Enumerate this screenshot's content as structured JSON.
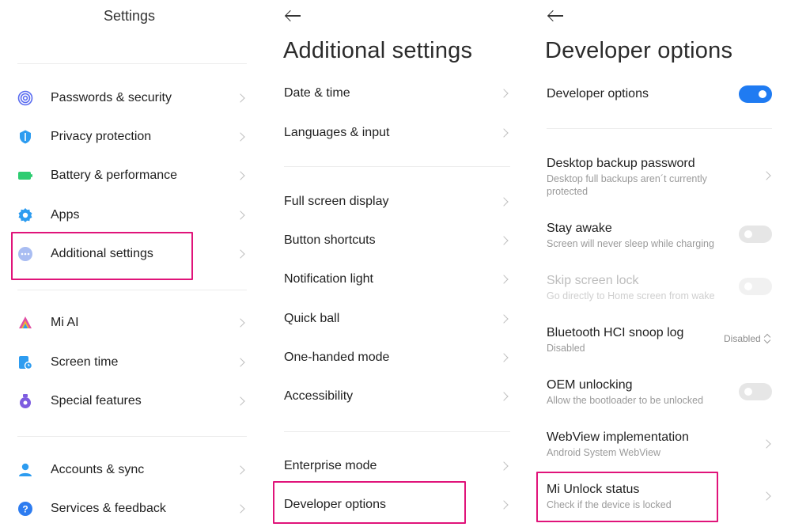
{
  "settings": {
    "title": "Settings",
    "items": [
      {
        "label": "Passwords & security",
        "icon": "fingerprint-icon",
        "color": "#5a6cf0"
      },
      {
        "label": "Privacy protection",
        "icon": "privacy-shield-icon",
        "color": "#2d9cf0"
      },
      {
        "label": "Battery & performance",
        "icon": "battery-icon",
        "color": "#2ecc71"
      },
      {
        "label": "Apps",
        "icon": "gear-icon",
        "color": "#2d9cf0"
      },
      {
        "label": "Additional settings",
        "icon": "more-dots-icon",
        "color": "#9fb4ef"
      },
      {
        "label": "Mi AI",
        "icon": "mi-ai-icon",
        "color": "#e04fa3"
      },
      {
        "label": "Screen time",
        "icon": "screen-time-icon",
        "color": "#2d9cf0"
      },
      {
        "label": "Special features",
        "icon": "special-features-icon",
        "color": "#7d5ce0"
      },
      {
        "label": "Accounts & sync",
        "icon": "person-icon",
        "color": "#2d9cf0"
      },
      {
        "label": "Services & feedback",
        "icon": "help-icon",
        "color": "#2d7cf0"
      }
    ]
  },
  "additional": {
    "title": "Additional settings",
    "items": [
      {
        "label": "Date & time"
      },
      {
        "label": "Languages & input"
      },
      {
        "label": "Full screen display"
      },
      {
        "label": "Button shortcuts"
      },
      {
        "label": "Notification light"
      },
      {
        "label": "Quick ball"
      },
      {
        "label": "One-handed mode"
      },
      {
        "label": "Accessibility"
      },
      {
        "label": "Enterprise mode"
      },
      {
        "label": "Developer options"
      }
    ]
  },
  "developer": {
    "title": "Developer options",
    "master_label": "Developer options",
    "master_on": true,
    "items": [
      {
        "title": "Desktop backup password",
        "subtitle": "Desktop full backups aren´t currently protected"
      },
      {
        "title": "Stay awake",
        "subtitle": "Screen will never sleep while charging"
      },
      {
        "title": "Skip screen lock",
        "subtitle": "Go directly to Home screen from wake"
      },
      {
        "title": "Bluetooth HCI snoop log",
        "subtitle": "Disabled",
        "value": "Disabled"
      },
      {
        "title": "OEM unlocking",
        "subtitle": "Allow the bootloader to be unlocked"
      },
      {
        "title": "WebView implementation",
        "subtitle": "Android System WebView"
      },
      {
        "title": "Mi Unlock status",
        "subtitle": "Check if the device is locked"
      }
    ]
  },
  "colors": {
    "highlight": "#e0147a",
    "toggle_on": "#1f7bf2"
  }
}
